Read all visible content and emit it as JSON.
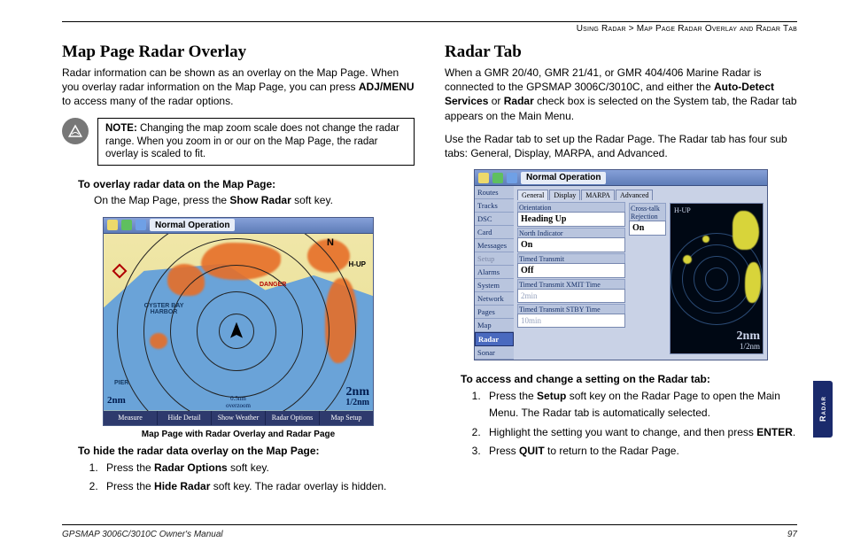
{
  "breadcrumb": {
    "section": "Using Radar",
    "sep": ">",
    "page": "Map Page Radar Overlay and Radar Tab"
  },
  "left": {
    "h1": "Map Page Radar Overlay",
    "intro_a": "Radar information can be shown as an overlay on the Map Page. When you overlay radar information on the Map Page, you can press ",
    "intro_key": "ADJ/MENU",
    "intro_b": " to access many of the radar options.",
    "note_label": "NOTE:",
    "note_text": " Changing the map zoom scale does not change the radar range. When you zoom in or our on the Map Page, the radar overlay is scaled to fit.",
    "overlay_head": "To overlay radar data on the Map Page:",
    "overlay_body_a": "On the Map Page, press the ",
    "overlay_body_key": "Show Radar",
    "overlay_body_b": " soft key.",
    "fig_caption": "Map Page with Radar Overlay and Radar Page",
    "hide_head": "To hide the radar data overlay on the Map Page:",
    "hide_steps": {
      "s1a": "Press the ",
      "s1k": "Radar Options",
      "s1b": " soft key.",
      "s2a": "Press the ",
      "s2k": "Hide Radar",
      "s2b": " soft key. The radar overlay is hidden."
    },
    "map": {
      "title": "Normal Operation",
      "harbor": "OYSTER BAY HARBOR",
      "danger": "DANGER",
      "north": "N",
      "hup": "H-UP",
      "pier": "PIER",
      "scale_left": "2nm",
      "scale_center_top": "0.5nm",
      "scale_center_bot": "overzoom",
      "scale_right_top": "2nm",
      "scale_right_bot": "1/2nm",
      "softkeys": [
        "Measure",
        "Hide Detail",
        "Show Weather",
        "Radar Options",
        "Map Setup"
      ]
    }
  },
  "right": {
    "h1": "Radar Tab",
    "intro_a": "When a GMR 20/40, GMR 21/41, or GMR 404/406 Marine Radar is connected to the GPSMAP 3006C/3010C, and either the ",
    "intro_k1": "Auto-Detect Services",
    "intro_mid": " or ",
    "intro_k2": "Radar",
    "intro_b": " check box is selected on the System tab, the Radar tab appears on the Main Menu.",
    "p2": "Use the Radar tab to set up the Radar Page. The Radar tab has four sub tabs: General, Display, MARPA, and Advanced.",
    "access_head": "To access and change a setting on the Radar tab:",
    "steps": {
      "s1a": "Press the ",
      "s1k": "Setup",
      "s1b": " soft key on the Radar Page to open the Main Menu. The Radar tab is automatically selected.",
      "s2a": "Highlight the setting you want to change, and then press ",
      "s2k": "ENTER",
      "s2b": ".",
      "s3a": "Press ",
      "s3k": "QUIT",
      "s3b": " to return to the Radar Page."
    },
    "setup": {
      "title": "Normal Operation",
      "side": [
        "Routes",
        "Tracks",
        "DSC",
        "Card",
        "Messages",
        "Setup",
        "Alarms",
        "System",
        "Network",
        "Pages",
        "Map",
        "Radar",
        "Sonar"
      ],
      "active_side": "Radar",
      "dim_side": "Setup",
      "subtabs": [
        "General",
        "Display",
        "MARPA",
        "Advanced"
      ],
      "rows": {
        "orientation_lbl": "Orientation",
        "orientation_val": "Heading Up",
        "north_lbl": "North Indicator",
        "north_val": "On",
        "timed_tx_lbl": "Timed Transmit",
        "timed_tx_val": "Off",
        "xmit_lbl": "Timed Transmit XMIT Time",
        "xmit_val": "2min",
        "stby_lbl": "Timed Transmit STBY Time",
        "stby_val": "10min",
        "cross_lbl": "Cross-talk Rejection",
        "cross_val": "On"
      },
      "scope": {
        "hup": "H-UP",
        "scale_top": "2nm",
        "scale_bot": "1/2nm"
      }
    }
  },
  "footer": {
    "left": "GPSMAP 3006C/3010C Owner's Manual",
    "right": "97"
  },
  "sidetab": "Radar"
}
